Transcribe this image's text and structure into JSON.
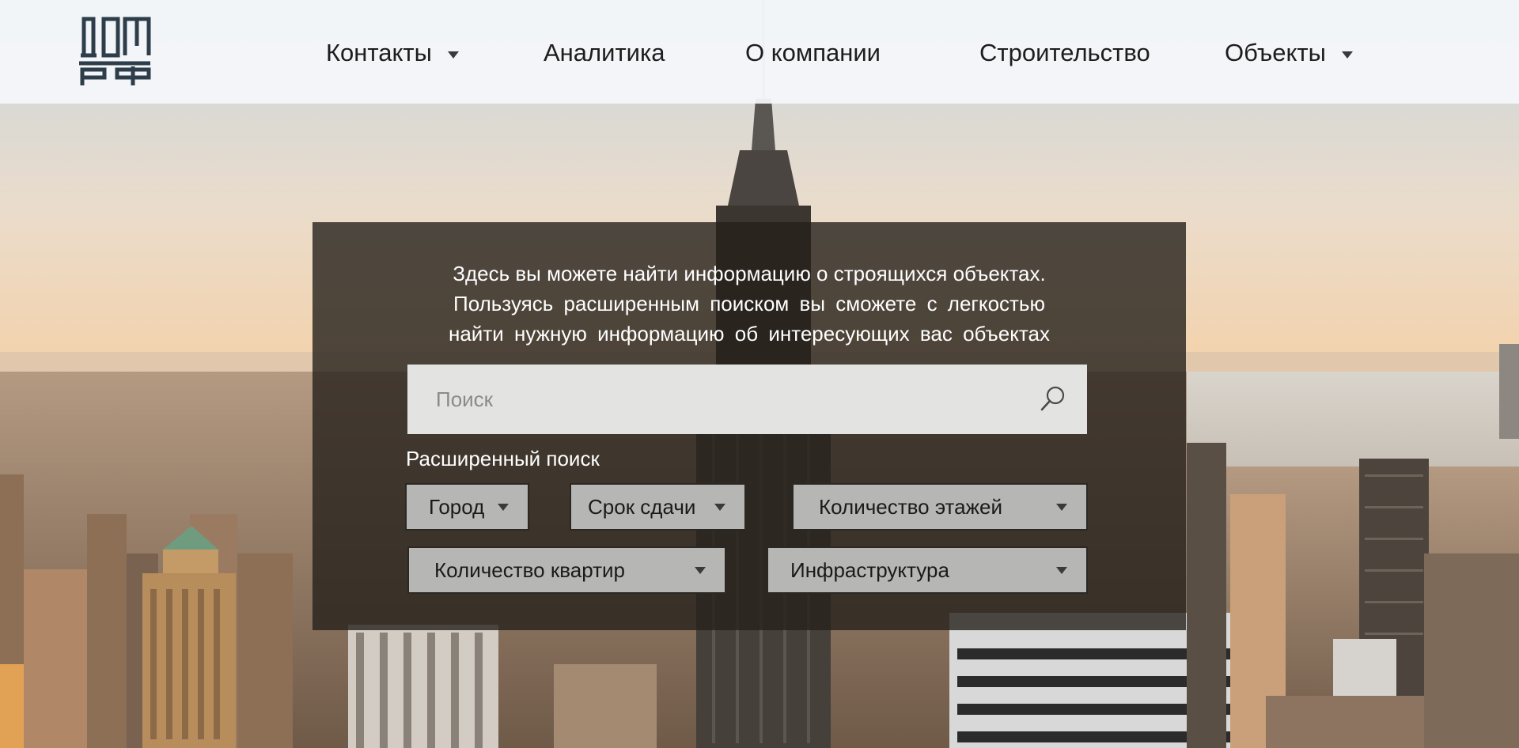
{
  "header": {
    "logo_alt": "ДОМ РФ",
    "nav": [
      {
        "label": "Контакты",
        "has_dropdown": true
      },
      {
        "label": "Аналитика",
        "has_dropdown": false
      },
      {
        "label": "О компании",
        "has_dropdown": false
      },
      {
        "label": "Строительство",
        "has_dropdown": false
      },
      {
        "label": "Объекты",
        "has_dropdown": true
      }
    ]
  },
  "hero": {
    "intro_lines": [
      "Здесь вы можете найти информацию о строящихся объектах.",
      "Пользуясь  расширенным  поиском  вы  сможете  с легкостью",
      "найти  нужную  информацию  об  интересующих  вас объектах"
    ],
    "search": {
      "placeholder": "Поиск",
      "value": "",
      "icon": "search-icon"
    },
    "advanced_search_label": "Расширенный поиск",
    "filters": [
      {
        "label": "Город",
        "icon": "chevron-down-icon"
      },
      {
        "label": "Срок сдачи",
        "icon": "chevron-down-icon"
      },
      {
        "label": "Количество этажей",
        "icon": "chevron-down-icon"
      },
      {
        "label": "Количество квартир",
        "icon": "chevron-down-icon"
      },
      {
        "label": "Инфраструктура",
        "icon": "chevron-down-icon"
      }
    ]
  },
  "colors": {
    "header_bg": "#f4f7fa",
    "panel_bg": "#26201b",
    "dropdown_bg": "#b6b6b4",
    "search_bg": "#e3e3e1",
    "logo": "#2d3d4a"
  }
}
